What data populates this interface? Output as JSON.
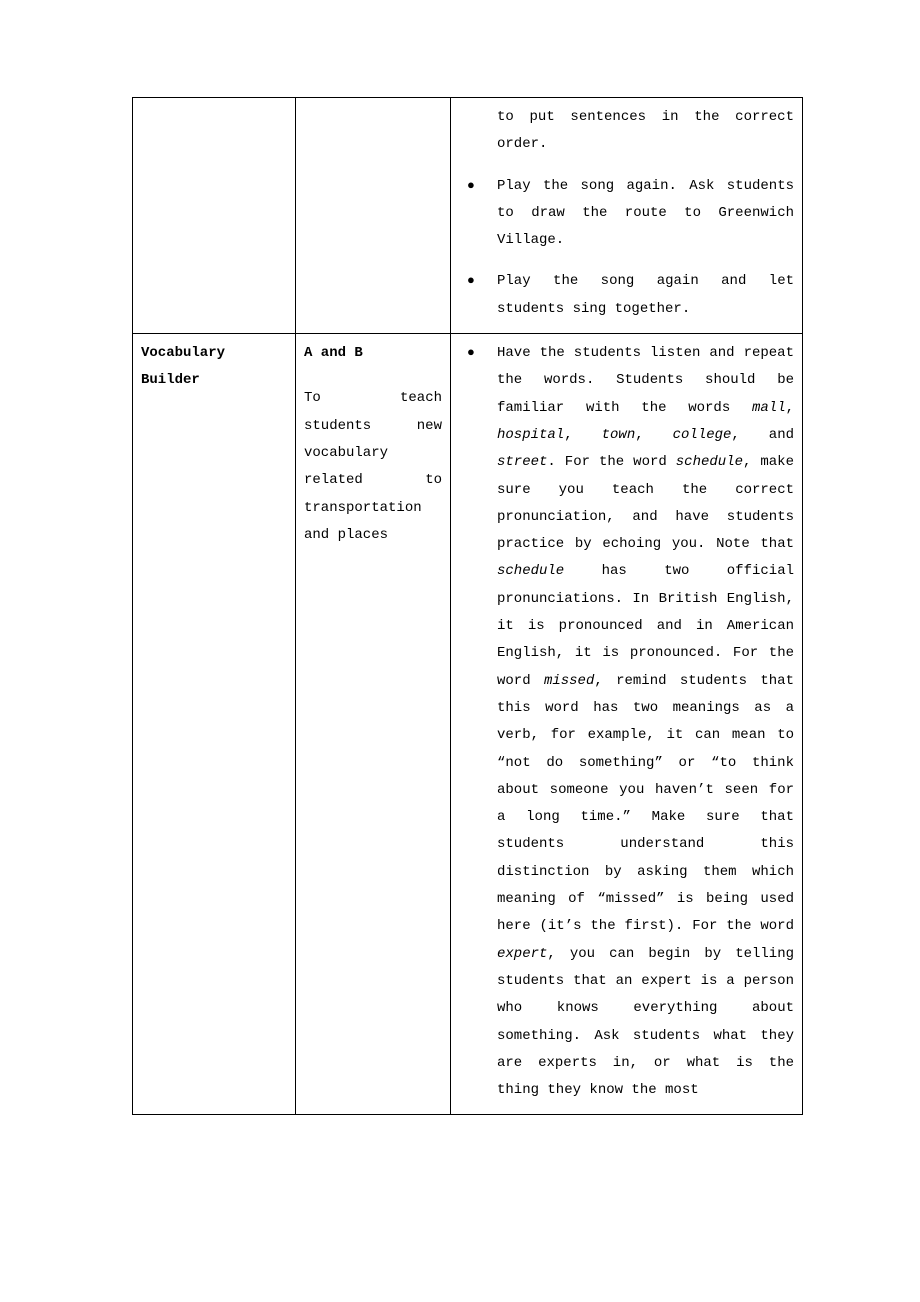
{
  "row1": {
    "col3": {
      "items": [
        {
          "pre": "to put sentences in the correct order."
        },
        {
          "pre": "Play the song again. Ask students to draw the route to Greenwich Village."
        },
        {
          "pre": "Play the song again and let students sing together."
        }
      ]
    }
  },
  "row2": {
    "col1": "Vocabulary Builder",
    "col2": {
      "heading": "A and B",
      "desc": "To teach students new vocabulary related to transportation and places"
    },
    "col3": {
      "item": {
        "p1a": "Have the students listen and repeat the words. Students should be familiar with the words ",
        "w1": "mall",
        "c1": ", ",
        "w2": "hospital",
        "c2": ", ",
        "w3": "town",
        "c3": ", ",
        "w4": "college",
        "c4": ", and ",
        "w5": "street",
        "p1b": ". For the word ",
        "w6": "schedule",
        "p1c": ", make sure you teach the correct pronunciation, and have students practice by echoing you. Note that ",
        "w7": "schedule",
        "p1d": " has two official pronunciations. In British English, it is pronounced and in American English, it is pronounced. For the word ",
        "w8": "missed",
        "p1e": ", remind students that this word has two meanings as a verb, for example, it can mean to “not do something” or “to think about someone you haven’t seen for a long time.” Make sure that students understand this distinction by asking them which meaning of “missed” is being used here (it’s the first). For the word ",
        "w9": "expert",
        "p1f": ", you can begin by telling students that an expert is a person who knows everything about something. Ask students what they are experts in, or what is the thing they know the most"
      }
    }
  }
}
